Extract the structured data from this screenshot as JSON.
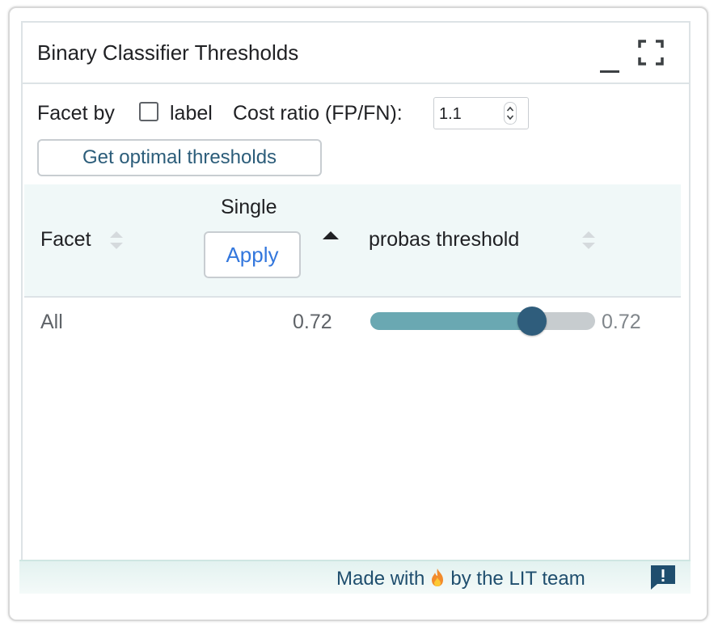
{
  "module": {
    "title": "Binary Classifier Thresholds"
  },
  "controls": {
    "facet_by_label": "Facet by",
    "facet_checkbox_label": "label",
    "facet_checked": false,
    "cost_ratio_label": "Cost ratio (FP/FN):",
    "cost_ratio_value": "1.1",
    "optimal_button_label": "Get optimal thresholds"
  },
  "table": {
    "headers": {
      "facet": "Facet",
      "single": "Single",
      "apply": "Apply",
      "probas": "probas threshold"
    },
    "rows": [
      {
        "facet": "All",
        "value": "0.72",
        "slider_fraction": 0.72,
        "slider_label": "0.72"
      }
    ]
  },
  "footer": {
    "made_with": "Made with",
    "by_team": "by the LIT team"
  },
  "icons": {
    "minimize": "minimize-icon",
    "expand": "fullscreen-icon",
    "sort": "sort-icon",
    "sort_active": "sort-ascending-icon",
    "flame": "flame-icon",
    "feedback": "feedback-icon"
  },
  "colors": {
    "slider_fill": "#6aa8b2",
    "slider_thumb": "#2f5d7c",
    "apply_text": "#3377dd",
    "header_bg": "#f0f8f8"
  }
}
